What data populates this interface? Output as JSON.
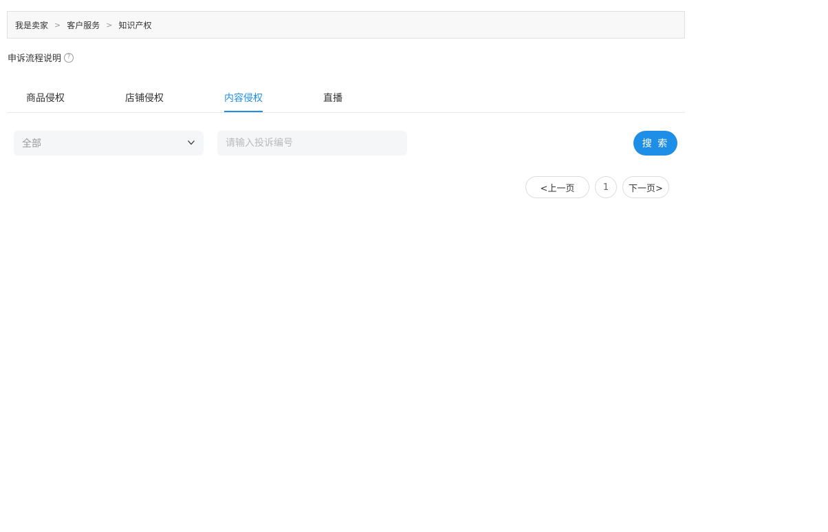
{
  "breadcrumb": {
    "items": [
      "我是卖家",
      "客户服务",
      "知识产权"
    ],
    "separator": ">"
  },
  "appeal_help": {
    "label": "申诉流程说明",
    "icon": "question-circle-icon",
    "icon_glyph": "?"
  },
  "tabs": [
    {
      "label": "商品侵权",
      "active": false
    },
    {
      "label": "店铺侵权",
      "active": false
    },
    {
      "label": "内容侵权",
      "active": true
    },
    {
      "label": "直播",
      "active": false
    }
  ],
  "filter": {
    "selected": "全部",
    "icon": "chevron-down-icon"
  },
  "search": {
    "placeholder": "请输入投诉编号",
    "value": "",
    "button_label": "搜 索"
  },
  "pagination": {
    "prev_label": "<上一页",
    "current_page": "1",
    "next_label": "下一页>"
  },
  "colors": {
    "accent": "#1e8ee6",
    "input_bg": "#f5f6f8",
    "breadcrumb_bg": "#f8f8f8"
  }
}
